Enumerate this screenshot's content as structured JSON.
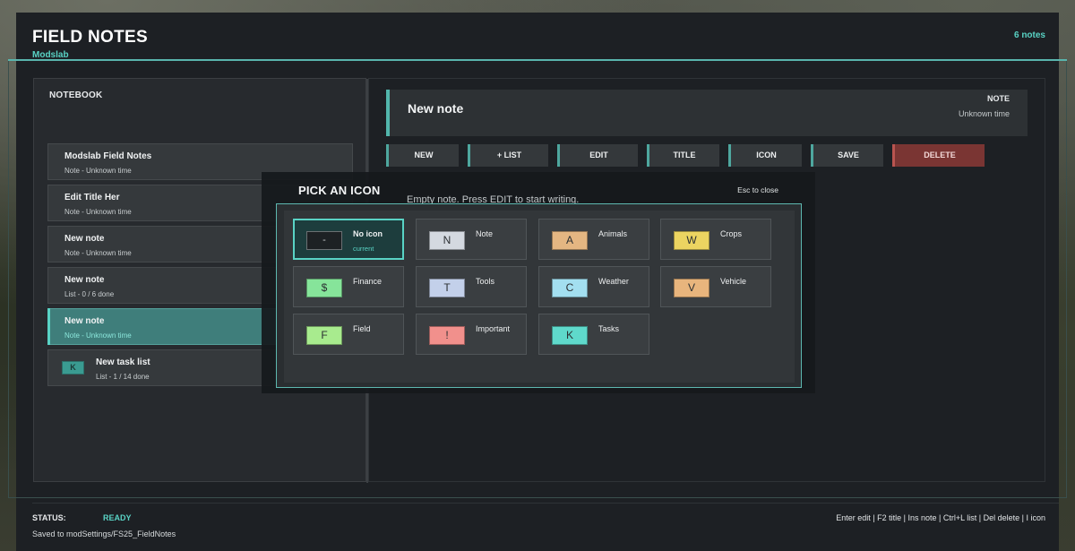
{
  "app": {
    "title": "FIELD NOTES",
    "subtitle": "Modslab",
    "note_count": "6 notes"
  },
  "notebook": {
    "label": "NOTEBOOK",
    "items": [
      {
        "title": "Modslab Field Notes",
        "meta": "Note - Unknown time"
      },
      {
        "title": "Edit Title Her",
        "meta": "Note - Unknown time"
      },
      {
        "title": "New note",
        "meta": "Note - Unknown time"
      },
      {
        "title": "New note",
        "meta": "List - 0 / 6 done"
      },
      {
        "title": "New note",
        "meta": "Note - Unknown time",
        "selected": true
      },
      {
        "title": "New task list",
        "meta": "List - 1 / 14 done",
        "icon": "K",
        "icon_color": "#3a9b91"
      }
    ]
  },
  "note": {
    "heading": "New note",
    "type": "NOTE",
    "time": "Unknown time",
    "empty_text": "Empty note. Press EDIT to start writing."
  },
  "toolbar": {
    "new": "NEW",
    "list": "+ LIST",
    "edit": "EDIT",
    "title": "TITLE",
    "icon": "ICON",
    "save": "SAVE",
    "delete": "DELETE"
  },
  "picker": {
    "title": "PICK AN ICON",
    "hint": "Esc to close",
    "options": [
      {
        "glyph": "-",
        "label": "No icon",
        "sub": "current",
        "color": "#1d2124"
      },
      {
        "glyph": "N",
        "label": "Note",
        "color": "#d4d9e0"
      },
      {
        "glyph": "A",
        "label": "Animals",
        "color": "#e4b682"
      },
      {
        "glyph": "W",
        "label": "Crops",
        "color": "#ecd461"
      },
      {
        "glyph": "$",
        "label": "Finance",
        "color": "#86e49a"
      },
      {
        "glyph": "T",
        "label": "Tools",
        "color": "#c3d0ea"
      },
      {
        "glyph": "C",
        "label": "Weather",
        "color": "#a3dff0"
      },
      {
        "glyph": "V",
        "label": "Vehicle",
        "color": "#e8b57d"
      },
      {
        "glyph": "F",
        "label": "Field",
        "color": "#a8eb8e"
      },
      {
        "glyph": "!",
        "label": "Important",
        "color": "#f1908c"
      },
      {
        "glyph": "K",
        "label": "Tasks",
        "color": "#5fd9cb"
      }
    ]
  },
  "footer": {
    "status_label": "STATUS:",
    "status_value": "READY",
    "saved_path": "Saved to modSettings/FS25_FieldNotes",
    "shortcuts": "Enter edit | F2 title | Ins note | Ctrl+L list | Del delete | I icon"
  },
  "colors": {
    "accent": "#59d3c5",
    "delete": "#7a3533",
    "selected_row": "#3f7e7b"
  }
}
